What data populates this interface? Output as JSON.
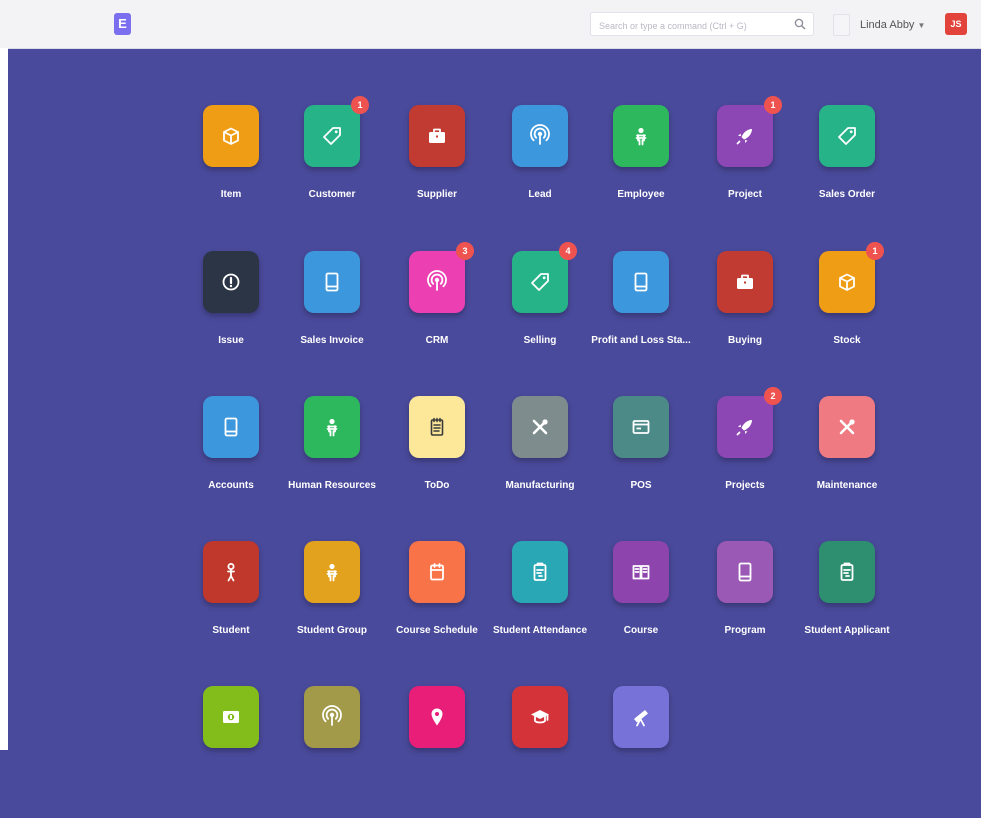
{
  "header": {
    "logo_text": "E",
    "search_placeholder": "Search or type a command (Ctrl + G)",
    "user_name": "Linda Abby",
    "user_initials": "JS"
  },
  "modules": [
    {
      "label": "Item",
      "color": "#ee9d14",
      "icon": "box-icon",
      "badge": ""
    },
    {
      "label": "Customer",
      "color": "#27b388",
      "icon": "tag-icon",
      "badge": "1"
    },
    {
      "label": "Supplier",
      "color": "#c23b32",
      "icon": "briefcase-icon",
      "badge": ""
    },
    {
      "label": "Lead",
      "color": "#3d97dc",
      "icon": "broadcast-icon",
      "badge": ""
    },
    {
      "label": "Employee",
      "color": "#2eb85e",
      "icon": "person-icon",
      "badge": ""
    },
    {
      "label": "Project",
      "color": "#8d47b5",
      "icon": "rocket-icon",
      "badge": "1"
    },
    {
      "label": "Sales Order",
      "color": "#27b388",
      "icon": "tag-icon",
      "badge": ""
    },
    {
      "label": "Issue",
      "color": "#2b3545",
      "icon": "alert-icon",
      "badge": ""
    },
    {
      "label": "Sales Invoice",
      "color": "#3d97dc",
      "icon": "tablet-icon",
      "badge": ""
    },
    {
      "label": "CRM",
      "color": "#eb3fb2",
      "icon": "broadcast-icon",
      "badge": "3"
    },
    {
      "label": "Selling",
      "color": "#27b388",
      "icon": "tag-icon",
      "badge": "4"
    },
    {
      "label": "Profit and Loss Sta...",
      "color": "#3d97dc",
      "icon": "tablet-icon",
      "badge": ""
    },
    {
      "label": "Buying",
      "color": "#c23b32",
      "icon": "briefcase-icon",
      "badge": ""
    },
    {
      "label": "Stock",
      "color": "#ee9d14",
      "icon": "box-icon",
      "badge": "1"
    },
    {
      "label": "Accounts",
      "color": "#3d97dc",
      "icon": "tablet-icon",
      "badge": ""
    },
    {
      "label": "Human Resources",
      "color": "#2eb85e",
      "icon": "person-icon",
      "badge": ""
    },
    {
      "label": "ToDo",
      "color": "#fde89a",
      "icon": "notepad-icon",
      "badge": ""
    },
    {
      "label": "Manufacturing",
      "color": "#7f8c8d",
      "icon": "tools-icon",
      "badge": ""
    },
    {
      "label": "POS",
      "color": "#4b8a86",
      "icon": "card-icon",
      "badge": ""
    },
    {
      "label": "Projects",
      "color": "#8d47b5",
      "icon": "rocket-icon",
      "badge": "2"
    },
    {
      "label": "Maintenance",
      "color": "#f07a82",
      "icon": "tools-icon",
      "badge": ""
    },
    {
      "label": "Student",
      "color": "#c0382b",
      "icon": "student-icon",
      "badge": ""
    },
    {
      "label": "Student Group",
      "color": "#e3a21d",
      "icon": "person-icon",
      "badge": ""
    },
    {
      "label": "Course Schedule",
      "color": "#f87347",
      "icon": "calendar-icon",
      "badge": ""
    },
    {
      "label": "Student Attendance",
      "color": "#2aa7b4",
      "icon": "clipboard-icon",
      "badge": ""
    },
    {
      "label": "Course",
      "color": "#8d44ad",
      "icon": "book-icon",
      "badge": ""
    },
    {
      "label": "Program",
      "color": "#9b59b6",
      "icon": "tablet-icon",
      "badge": ""
    },
    {
      "label": "Student Applicant",
      "color": "#2e8f70",
      "icon": "clipboard-icon",
      "badge": ""
    },
    {
      "label": "",
      "color": "#83bd1c",
      "icon": "money-icon",
      "badge": ""
    },
    {
      "label": "",
      "color": "#a29a48",
      "icon": "broadcast-icon",
      "badge": ""
    },
    {
      "label": "",
      "color": "#e81e78",
      "icon": "location-icon",
      "badge": ""
    },
    {
      "label": "",
      "color": "#d5333a",
      "icon": "graduation-icon",
      "badge": ""
    },
    {
      "label": "",
      "color": "#7672d8",
      "icon": "telescope-icon",
      "badge": ""
    }
  ]
}
